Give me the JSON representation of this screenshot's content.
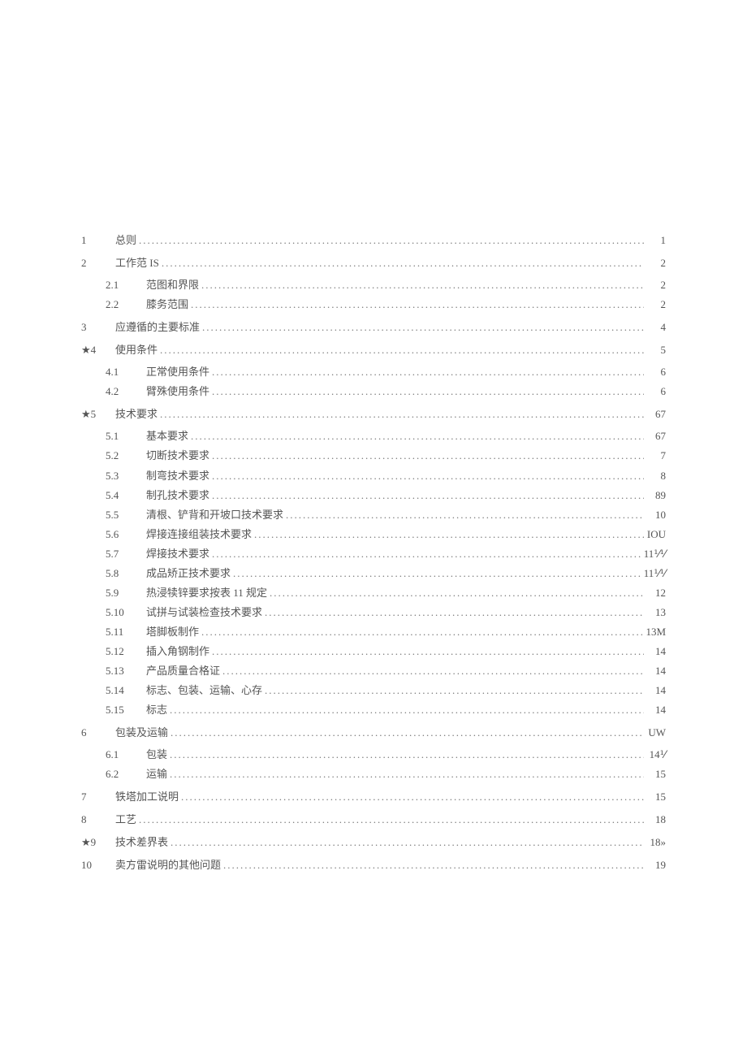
{
  "toc": [
    {
      "num": "1",
      "title": "总则",
      "page": "1",
      "sub": []
    },
    {
      "num": "2",
      "title": "工作范 IS",
      "page": "2",
      "sub": [
        {
          "num": "2.1",
          "title": "范图和界限",
          "page": "2"
        },
        {
          "num": "2.2",
          "title": "膝务范围",
          "page": "2"
        }
      ]
    },
    {
      "num": "3",
      "title": "应遵循的主要标准",
      "page": "4",
      "sub": []
    },
    {
      "num": "★4",
      "title": "使用条件",
      "page": "5",
      "sub": [
        {
          "num": "4.1",
          "title": "正常使用条件",
          "page": "6"
        },
        {
          "num": "4.2",
          "title": "臂殊使用条件",
          "page": "6"
        }
      ]
    },
    {
      "num": "★5",
      "title": "技术要求",
      "page": "67",
      "sub": [
        {
          "num": "5.1",
          "title": "基本要求",
          "page": "67"
        },
        {
          "num": "5.2",
          "title": "切断技术要求",
          "page": "7"
        },
        {
          "num": "5.3",
          "title": "制弯技术要求",
          "page": "8"
        },
        {
          "num": "5.4",
          "title": "制孔技术要求",
          "page": "89"
        },
        {
          "num": "5.5",
          "title": "清根、铲背和开坡口技术要求",
          "page": "10"
        },
        {
          "num": "5.6",
          "title": "焊接连接组装技术要求",
          "page": "IOU"
        },
        {
          "num": "5.7",
          "title": "焊接技术要求",
          "page": "11⅟⅟"
        },
        {
          "num": "5.8",
          "title": "成品矫正技术要求",
          "page": "11⅟⅟"
        },
        {
          "num": "5.9",
          "title": "热浸犊锌要求按表 11 规定",
          "page": "12"
        },
        {
          "num": "5.10",
          "title": "试拼与试装检查技术要求",
          "page": "13"
        },
        {
          "num": "5.11",
          "title": "塔脚板制作",
          "page": "13M"
        },
        {
          "num": "5.12",
          "title": "插入角钢制作",
          "page": "14"
        },
        {
          "num": "5.13",
          "title": "产品质量合格证",
          "page": "14"
        },
        {
          "num": "5.14",
          "title": "标志、包装、运输、心存",
          "page": "14"
        },
        {
          "num": "5.15",
          "title": "标志",
          "page": "14"
        }
      ]
    },
    {
      "num": "6",
      "title": "包装及运输",
      "page": "UW",
      "sub": [
        {
          "num": "6.1",
          "title": "包装",
          "page": "14⅟"
        },
        {
          "num": "6.2",
          "title": "运输",
          "page": "15"
        }
      ]
    },
    {
      "num": "7",
      "title": "铁塔加工说明",
      "page": "15",
      "sub": []
    },
    {
      "num": "8",
      "title": "工艺",
      "page": "18",
      "sub": []
    },
    {
      "num": "★9",
      "title": "技术差界表",
      "page": "18»",
      "sub": []
    },
    {
      "num": "10",
      "title": "卖方雷说明的其他问题",
      "page": "19",
      "sub": []
    }
  ]
}
